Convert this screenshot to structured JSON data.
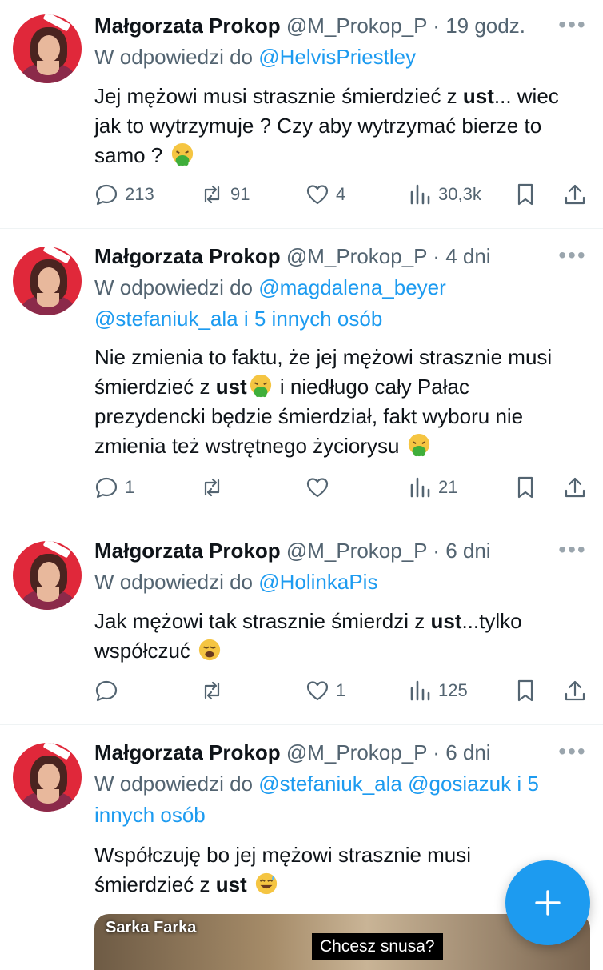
{
  "tweets": [
    {
      "name": "Małgorzata Prokop",
      "handle": "@M_Prokop_P",
      "dot": "·",
      "time": "19 godz.",
      "reply_prefix": "W odpowiedzi do",
      "mentions": [
        "@HelvisPriestley"
      ],
      "reply_suffix": "",
      "text_parts": [
        "Jej mężowi musi strasznie śmierdzieć z ",
        "ust",
        "... wiec jak to wytrzymuje ? Czy aby wytrzymać bierze to samo ? "
      ],
      "replies": "213",
      "reposts": "91",
      "likes": "4",
      "views": "30,3k"
    },
    {
      "name": "Małgorzata Prokop",
      "handle": "@M_Prokop_P",
      "dot": "·",
      "time": "4 dni",
      "reply_prefix": "W odpowiedzi do",
      "mentions": [
        "@magdalena_beyer",
        "@stefaniuk_ala"
      ],
      "reply_suffix": "i 5 innych osób",
      "text_parts": [
        "Nie zmienia to faktu, że jej mężowi strasznie musi śmierdzieć z ",
        "ust",
        " i niedługo cały Pałac prezydencki będzie śmierdział, fakt wyboru nie zmienia też wstrętnego życiorysu "
      ],
      "replies": "1",
      "reposts": "",
      "likes": "",
      "views": "21"
    },
    {
      "name": "Małgorzata Prokop",
      "handle": "@M_Prokop_P",
      "dot": "·",
      "time": "6 dni",
      "reply_prefix": "W odpowiedzi do",
      "mentions": [
        "@HolinkaPis"
      ],
      "reply_suffix": "",
      "text_parts": [
        "Jak mężowi tak strasznie śmierdzi z ",
        "ust",
        "...tylko współczuć "
      ],
      "replies": "",
      "reposts": "",
      "likes": "1",
      "views": "125"
    },
    {
      "name": "Małgorzata Prokop",
      "handle": "@M_Prokop_P",
      "dot": "·",
      "time": "6 dni",
      "reply_prefix": "W odpowiedzi do",
      "mentions": [
        "@stefaniuk_ala",
        "@gosiazuk"
      ],
      "reply_suffix": "i 5 innych osób",
      "text_parts": [
        "Współczuję bo jej mężowi strasznie musi śmierdzieć z ",
        "ust",
        " "
      ],
      "media_title": "Sarka Farka",
      "media_caption": "Chcesz snusa?"
    }
  ],
  "colors": {
    "accent": "#1d9bf0",
    "muted": "#536471",
    "text": "#0f1419"
  },
  "icons": [
    "reply-icon",
    "repost-icon",
    "like-icon",
    "views-icon",
    "bookmark-icon",
    "share-icon",
    "more-icon",
    "compose-plus-icon",
    "vomiting-face-emoji",
    "weary-face-emoji",
    "sweat-smile-emoji"
  ]
}
